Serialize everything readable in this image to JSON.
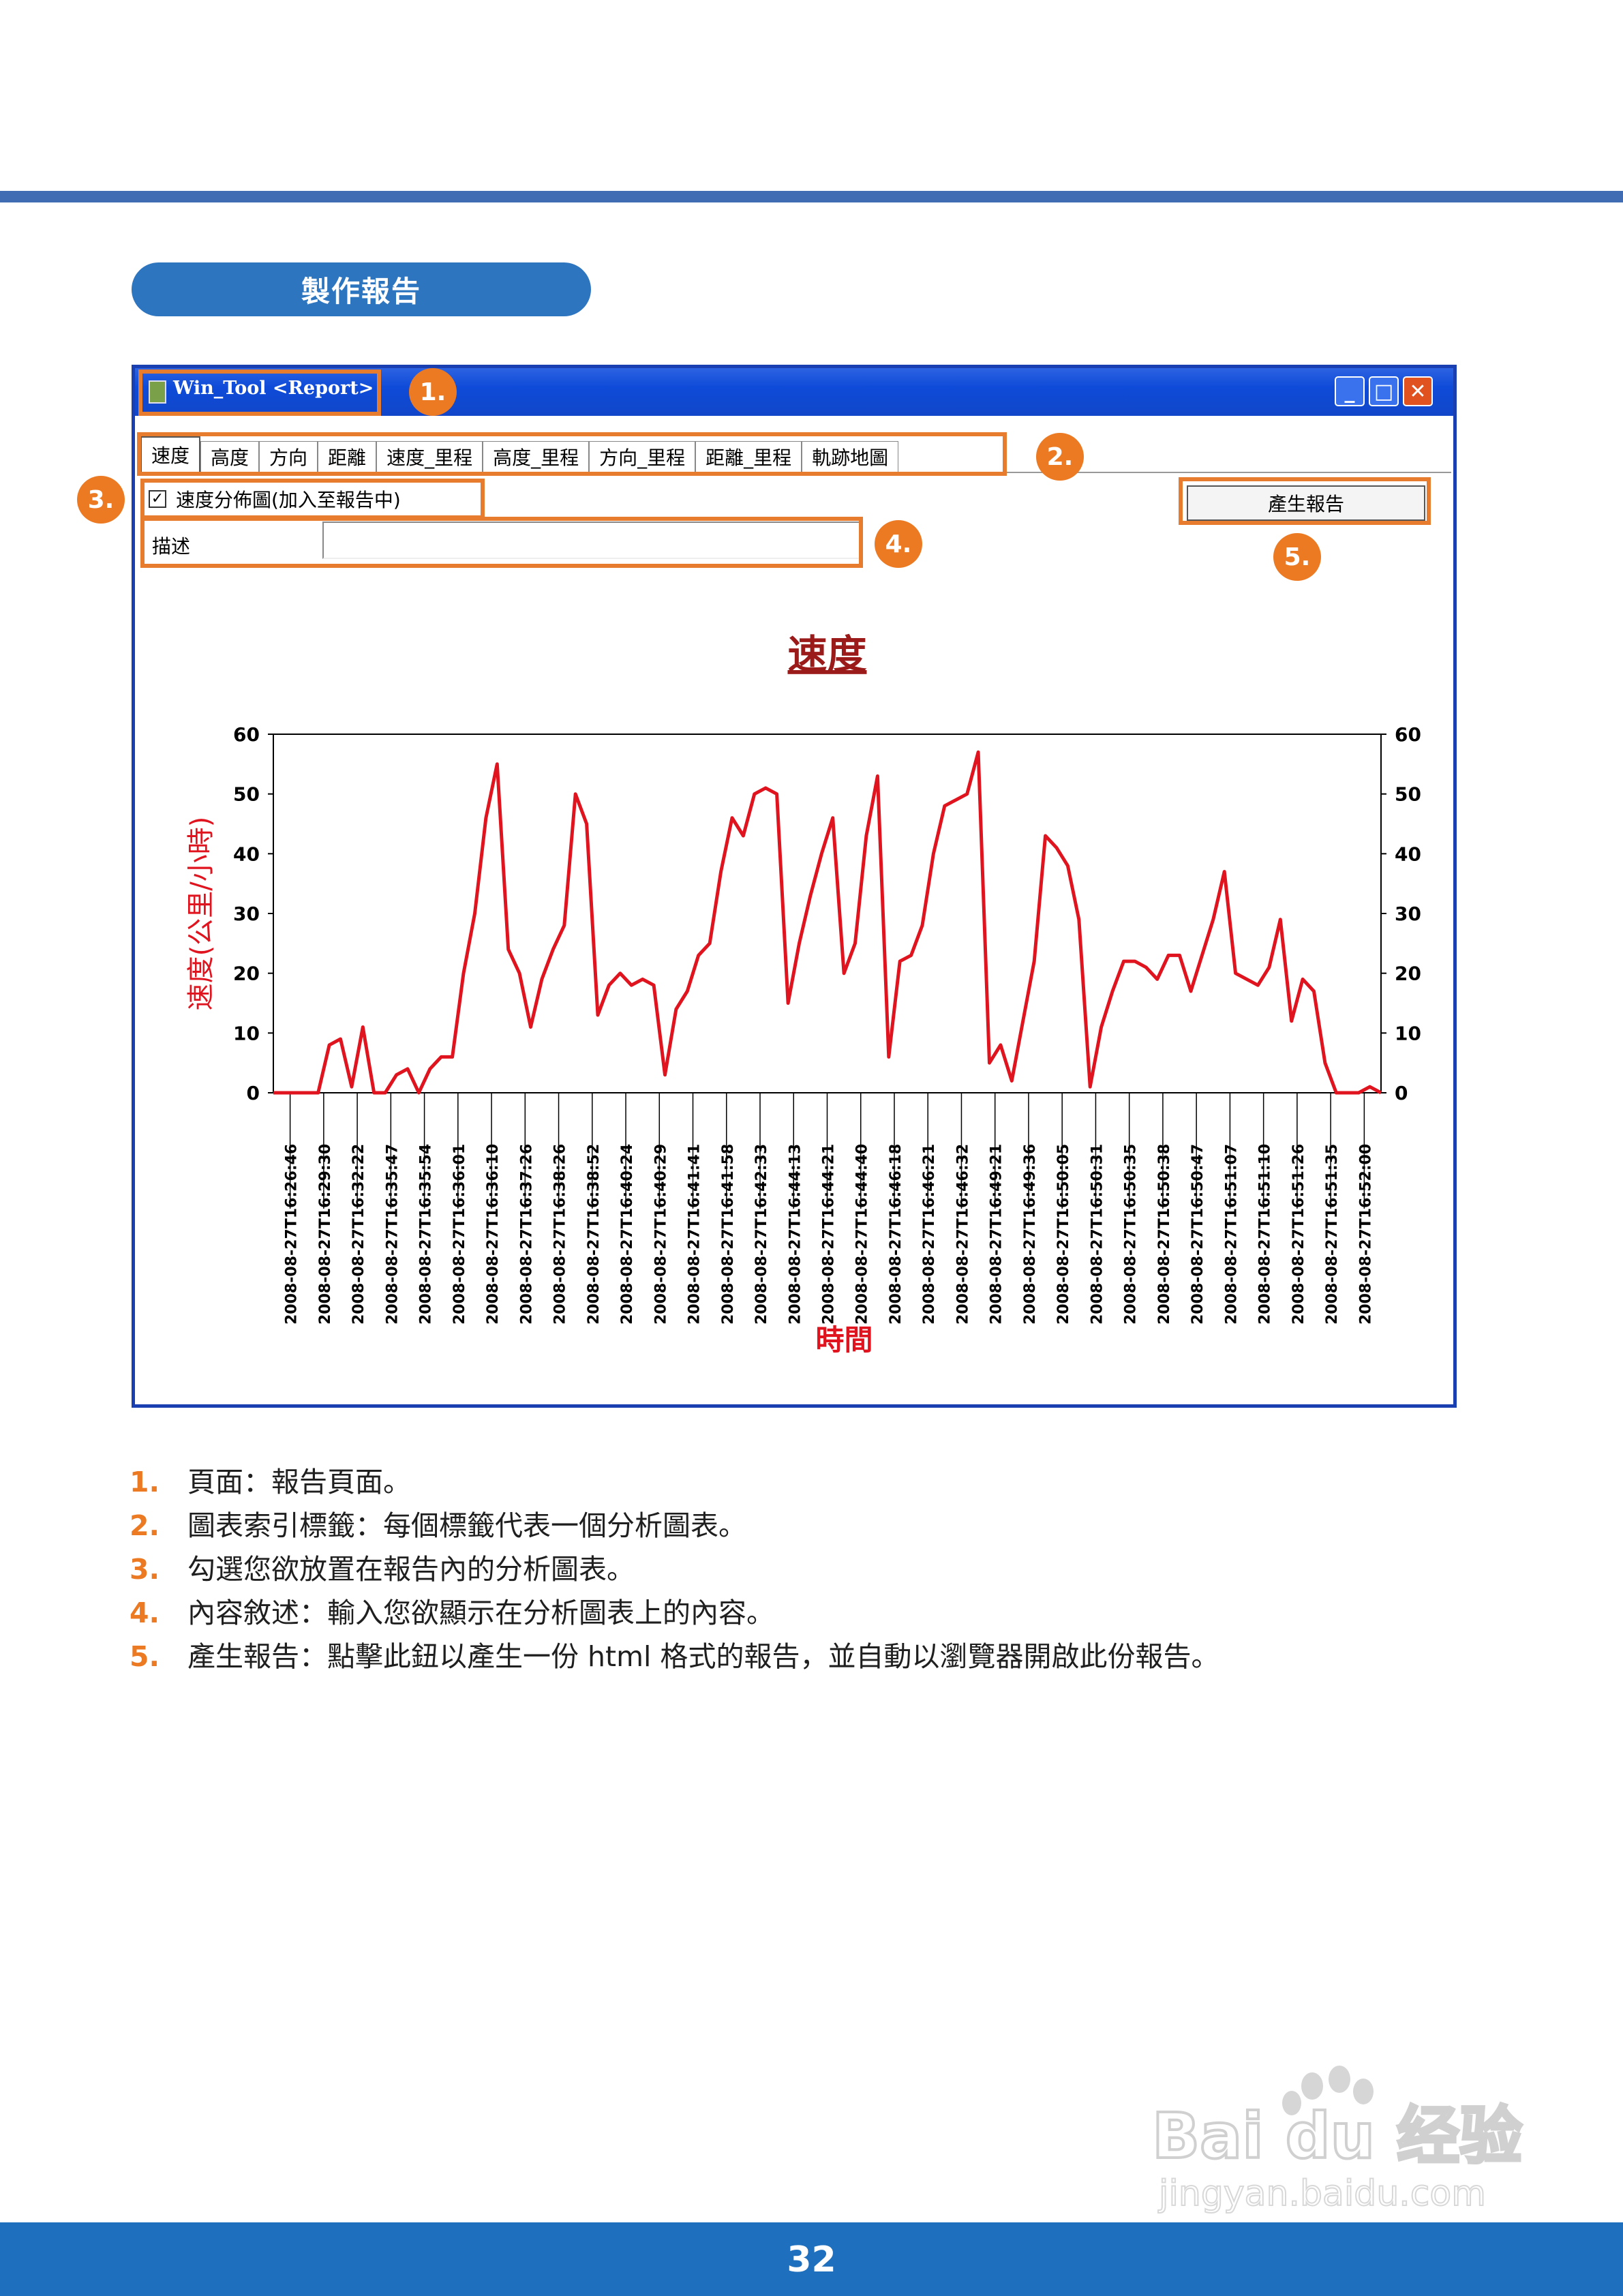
{
  "section_title": "製作報告",
  "window": {
    "title": "Win_Tool <Report>",
    "controls": {
      "minimize": "_",
      "maximize": "□",
      "close": "✕"
    }
  },
  "tabs": [
    "速度",
    "高度",
    "方向",
    "距離",
    "速度_里程",
    "高度_里程",
    "方向_里程",
    "距離_里程",
    "軌跡地圖"
  ],
  "active_tab": 0,
  "checkbox": {
    "mark": "✓",
    "label": "速度分佈圖(加入至報告中)",
    "checked": true
  },
  "description": {
    "label": "描述",
    "value": ""
  },
  "generate_button": "產生報告",
  "badges": [
    "1.",
    "2.",
    "3.",
    "4.",
    "5."
  ],
  "chart_data": {
    "type": "line",
    "title": "速度",
    "xlabel": "時間",
    "ylabel": "速度(公里/小時)",
    "ylim": [
      0,
      60
    ],
    "yticks": [
      0,
      10,
      20,
      30,
      40,
      50,
      60
    ],
    "dual_y_axis": true,
    "color": "#e0141e",
    "categories": [
      "2008-08-27T16:26:46",
      "2008-08-27T16:29:30",
      "2008-08-27T16:32:22",
      "2008-08-27T16:35:47",
      "2008-08-27T16:35:54",
      "2008-08-27T16:36:01",
      "2008-08-27T16:36:10",
      "2008-08-27T16:37:26",
      "2008-08-27T16:38:26",
      "2008-08-27T16:38:52",
      "2008-08-27T16:40:24",
      "2008-08-27T16:40:29",
      "2008-08-27T16:41:41",
      "2008-08-27T16:41:58",
      "2008-08-27T16:42:33",
      "2008-08-27T16:44:13",
      "2008-08-27T16:44:21",
      "2008-08-27T16:44:40",
      "2008-08-27T16:46:18",
      "2008-08-27T16:46:21",
      "2008-08-27T16:46:32",
      "2008-08-27T16:49:21",
      "2008-08-27T16:49:36",
      "2008-08-27T16:50:05",
      "2008-08-27T16:50:31",
      "2008-08-27T16:50:35",
      "2008-08-27T16:50:38",
      "2008-08-27T16:50:47",
      "2008-08-27T16:51:07",
      "2008-08-27T16:51:10",
      "2008-08-27T16:51:26",
      "2008-08-27T16:51:35",
      "2008-08-27T16:52:00"
    ],
    "values": [
      0,
      0,
      0,
      0,
      0,
      8,
      9,
      1,
      11,
      0,
      0,
      3,
      4,
      0,
      4,
      6,
      6,
      20,
      30,
      46,
      55,
      24,
      20,
      11,
      19,
      24,
      28,
      50,
      45,
      13,
      18,
      20,
      18,
      19,
      18,
      3,
      14,
      17,
      23,
      25,
      37,
      46,
      43,
      50,
      51,
      50,
      15,
      25,
      33,
      40,
      46,
      20,
      25,
      43,
      53,
      6,
      22,
      23,
      28,
      40,
      48,
      49,
      50,
      57,
      5,
      8,
      2,
      12,
      22,
      43,
      41,
      38,
      29,
      1,
      11,
      17,
      22,
      22,
      21,
      19,
      23,
      23,
      17,
      23,
      29,
      37,
      20,
      19,
      18,
      21,
      29,
      12,
      19,
      17,
      5,
      0,
      0,
      0,
      1,
      0
    ]
  },
  "notes": [
    {
      "num": "1.",
      "text": "頁面：報告頁面。"
    },
    {
      "num": "2.",
      "text": "圖表索引標籤：每個標籤代表一個分析圖表。"
    },
    {
      "num": "3.",
      "text": "勾選您欲放置在報告內的分析圖表。"
    },
    {
      "num": "4.",
      "text": "內容敘述：輸入您欲顯示在分析圖表上的內容。"
    },
    {
      "num": "5.",
      "text": "產生報告：點擊此鈕以產生一份 html 格式的報告，並自動以瀏覽器開啟此份報告。"
    }
  ],
  "page_number": "32",
  "watermark": {
    "brand": "Bai du 经验",
    "url": "jingyan.baidu.com"
  }
}
